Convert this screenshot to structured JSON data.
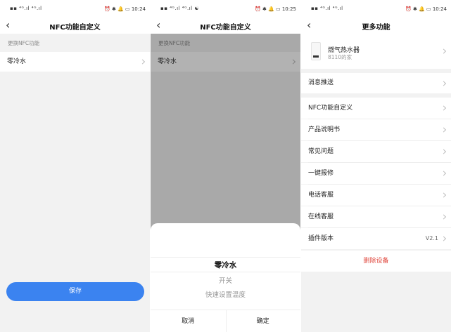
{
  "status": {
    "s1_left": "▪▪ ⁴ᴳ.ıl ⁴ᴳ.ıl",
    "s1_right": "⏰ ✱ 🔔 ▭ 10:24",
    "s2_left": "▪▪ ⁴ᴳ.ıl ⁴ᴳ.ıl ☯",
    "s2_right": "⏰ ✱ 🔔 ▭ 10:25",
    "s3_left": "▪▪ ⁴ᴳ.ıl ⁴ᴳ.ıl",
    "s3_right": "⏰ ✱ 🔔 ▭ 10:24"
  },
  "screen1": {
    "title": "NFC功能自定义",
    "section": "更换NFC功能",
    "item": "零冷水",
    "save": "保存"
  },
  "screen2": {
    "title": "NFC功能自定义",
    "section": "更换NFC功能",
    "item": "零冷水",
    "picker": {
      "selected": "零冷水",
      "option1": "开关",
      "option2": "快速设置温度"
    },
    "cancel": "取消",
    "confirm": "确定"
  },
  "screen3": {
    "title": "更多功能",
    "device_name": "燃气热水器",
    "device_sub": "8110的家",
    "push": "消息推送",
    "items": [
      "NFC功能自定义",
      "产品说明书",
      "常见问题",
      "一键报修",
      "电话客服",
      "在线客服",
      "插件版本"
    ],
    "version": "V2.1",
    "delete": "删除设备"
  },
  "colors": {
    "accent": "#3b83f0",
    "danger": "#e0483e"
  }
}
